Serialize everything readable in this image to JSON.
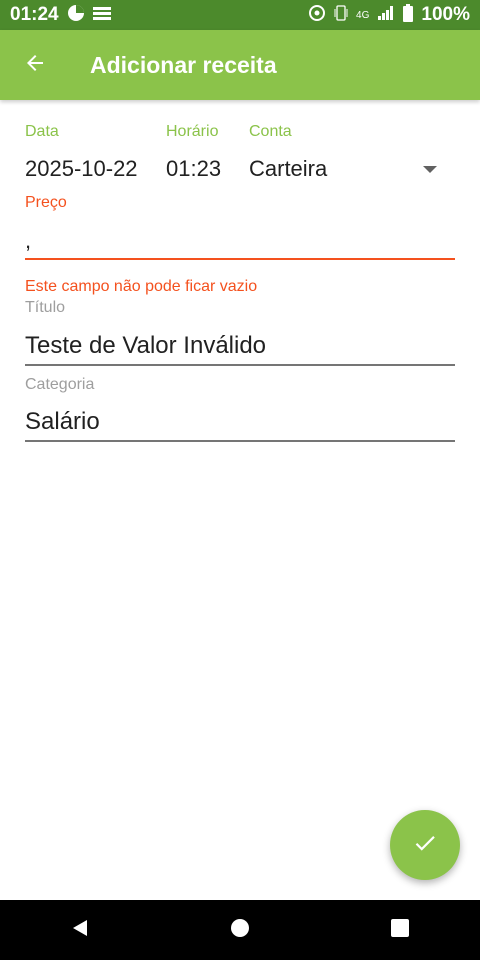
{
  "status_bar": {
    "time": "01:24",
    "battery": "100%",
    "network_label": "4G"
  },
  "app_bar": {
    "title": "Adicionar receita",
    "back_icon": "arrow-back-icon"
  },
  "form": {
    "date": {
      "label": "Data",
      "value": "2025-10-22"
    },
    "time": {
      "label": "Horário",
      "value": "01:23"
    },
    "account": {
      "label": "Conta",
      "value": "Carteira"
    },
    "price": {
      "label": "Preço",
      "value": ",",
      "error": "Este campo não pode ficar vazio"
    },
    "title": {
      "label": "Título",
      "value": "Teste de Valor Inválido"
    },
    "category": {
      "label": "Categoria",
      "value": "Salário"
    }
  },
  "fab": {
    "icon": "check-icon"
  },
  "colors": {
    "primary": "#8bc34a",
    "primary_dark": "#4c8a2c",
    "error": "#f4511e"
  }
}
